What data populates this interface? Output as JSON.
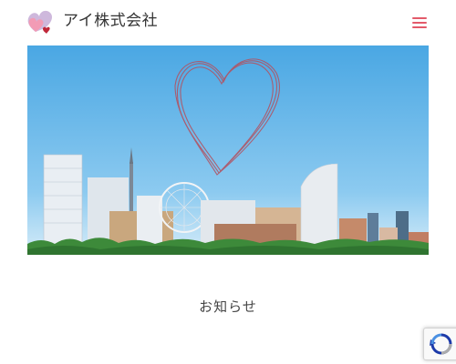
{
  "header": {
    "brand_name": "アイ株式会社",
    "menu_icon": "hamburger-menu-icon",
    "accent_color": "#e35a6a"
  },
  "hero": {
    "image": "yokohama-skyline-heart-photo"
  },
  "main": {
    "section_title": "お知らせ"
  },
  "recaptcha": {
    "icon": "recaptcha-icon"
  }
}
